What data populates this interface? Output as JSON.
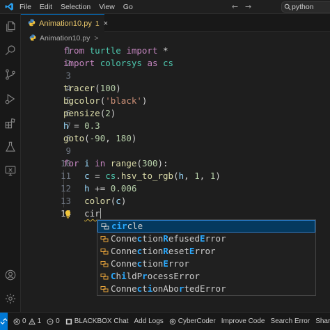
{
  "titlebar": {
    "menu": [
      "File",
      "Edit",
      "Selection",
      "View",
      "Go"
    ],
    "search_text": "python",
    "nav_back": "←",
    "nav_forward": "→"
  },
  "tab": {
    "label": "Animation10.py",
    "badge": "1",
    "close": "×"
  },
  "breadcrumb": {
    "file": "Animation10.py",
    "separator": ">"
  },
  "editor": {
    "line_numbers": [
      "1",
      "2",
      "3",
      "4",
      "5",
      "6",
      "7",
      "8",
      "9",
      "10",
      "11",
      "12",
      "13",
      "14"
    ],
    "line1": {
      "k1": "from",
      "m1": "turtle",
      "k2": "import",
      "p1": "*"
    },
    "line2": {
      "k1": "import",
      "m1": "colorsys",
      "k2": "as",
      "m2": "cs"
    },
    "line4": {
      "f": "tracer",
      "p1": "(",
      "n": "100",
      "p2": ")"
    },
    "line5": {
      "f": "bgcolor",
      "p1": "(",
      "s": "'black'",
      "p2": ")"
    },
    "line6": {
      "f": "pensize",
      "p1": "(",
      "n": "2",
      "p2": ")"
    },
    "line7": {
      "v": "h",
      "op": "=",
      "n": "0.3"
    },
    "line8": {
      "f": "goto",
      "p1": "(",
      "n1": "-90",
      "c": ",",
      "n2": "180",
      "p2": ")"
    },
    "line10": {
      "k1": "for",
      "v": "i",
      "k2": "in",
      "f": "range",
      "p1": "(",
      "n": "300",
      "p2": "):"
    },
    "line11": {
      "v1": "c",
      "op": "=",
      "m": "cs",
      "dot": ".",
      "f": "hsv_to_rgb",
      "p1": "(",
      "v2": "h",
      "c1": ",",
      "n1": "1",
      "c2": ",",
      "n2": "1",
      "p2": ")"
    },
    "line12": {
      "v": "h",
      "op": "+=",
      "n": "0.006"
    },
    "line13": {
      "f": "color",
      "p1": "(",
      "v": "c",
      "p2": ")"
    },
    "line14": {
      "typed": "cir"
    }
  },
  "suggestions": [
    {
      "match": "cir",
      "rest": "cle"
    },
    {
      "pre": "Conne",
      "m1": "c",
      "mid1": "tion",
      "m2": "R",
      "mid2": "efused",
      "m3": "E",
      "rest": "rror"
    },
    {
      "pre": "Conne",
      "m1": "c",
      "mid1": "tion",
      "m2": "R",
      "mid2": "eset",
      "m3": "E",
      "rest": "rror"
    },
    {
      "pre": "Conne",
      "m1": "c",
      "mid1": "tion",
      "m2": "E",
      "rest": "rror"
    },
    {
      "m1": "C",
      "mid1": "h",
      "m2": "i",
      "mid2": "ldP",
      "m3": "r",
      "rest": "ocessError"
    },
    {
      "pre": "Conne",
      "m1": "c",
      "mid1": "t",
      "m2": "i",
      "mid2": "onAbo",
      "m3": "r",
      "rest": "tedError"
    }
  ],
  "statusbar": {
    "errors": "0",
    "warnings": "1",
    "ports": "0",
    "items": [
      "BLACKBOX Chat",
      "Add Logs",
      "CyberCoder",
      "Improve Code",
      "Search Error",
      "Share Co"
    ]
  },
  "colors": {
    "accent": "#0078d4",
    "modified_tab": "#e8c66a",
    "match_highlight": "#2aaaff"
  }
}
